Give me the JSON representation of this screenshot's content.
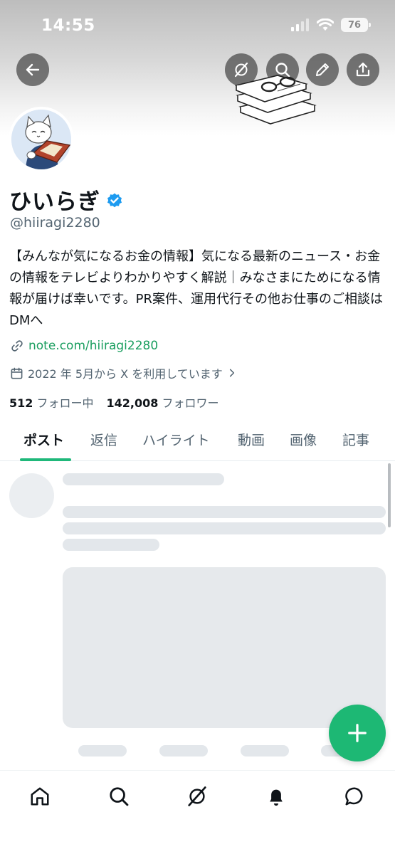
{
  "status": {
    "time": "14:55",
    "battery": "76"
  },
  "icons": {
    "back": "back-arrow-icon",
    "grok": "grok-icon",
    "search": "search-icon",
    "compose": "pencil-icon",
    "share": "share-icon",
    "verified": "verified-badge-icon",
    "link": "link-icon",
    "calendar": "calendar-icon"
  },
  "profile": {
    "name": "ひいらぎ",
    "handle": "@hiiragi2280",
    "bio": "【みんなが気になるお金の情報】気になる最新のニュース・お金の情報をテレビよりわかりやすく解説｜みなさまにためになる情報が届けば幸いです。PR案件、運用代行その他お仕事のご相談はDMへ",
    "link": "note.com/hiiragi2280",
    "joined": "2022 年 5月から X を利用しています",
    "following_count": "512",
    "following_label": "フォロー中",
    "followers_count": "142,008",
    "followers_label": "フォロワー"
  },
  "tabs": [
    "ポスト",
    "返信",
    "ハイライト",
    "動画",
    "画像",
    "記事"
  ],
  "active_tab": "ポスト",
  "colors": {
    "accent": "#1db874",
    "link": "#1a9e5f",
    "verified": "#1d9bf0",
    "secondary_text": "#536471"
  },
  "bottom_nav": [
    "home-icon",
    "search-icon",
    "grok-icon",
    "notifications-icon",
    "messages-icon"
  ]
}
